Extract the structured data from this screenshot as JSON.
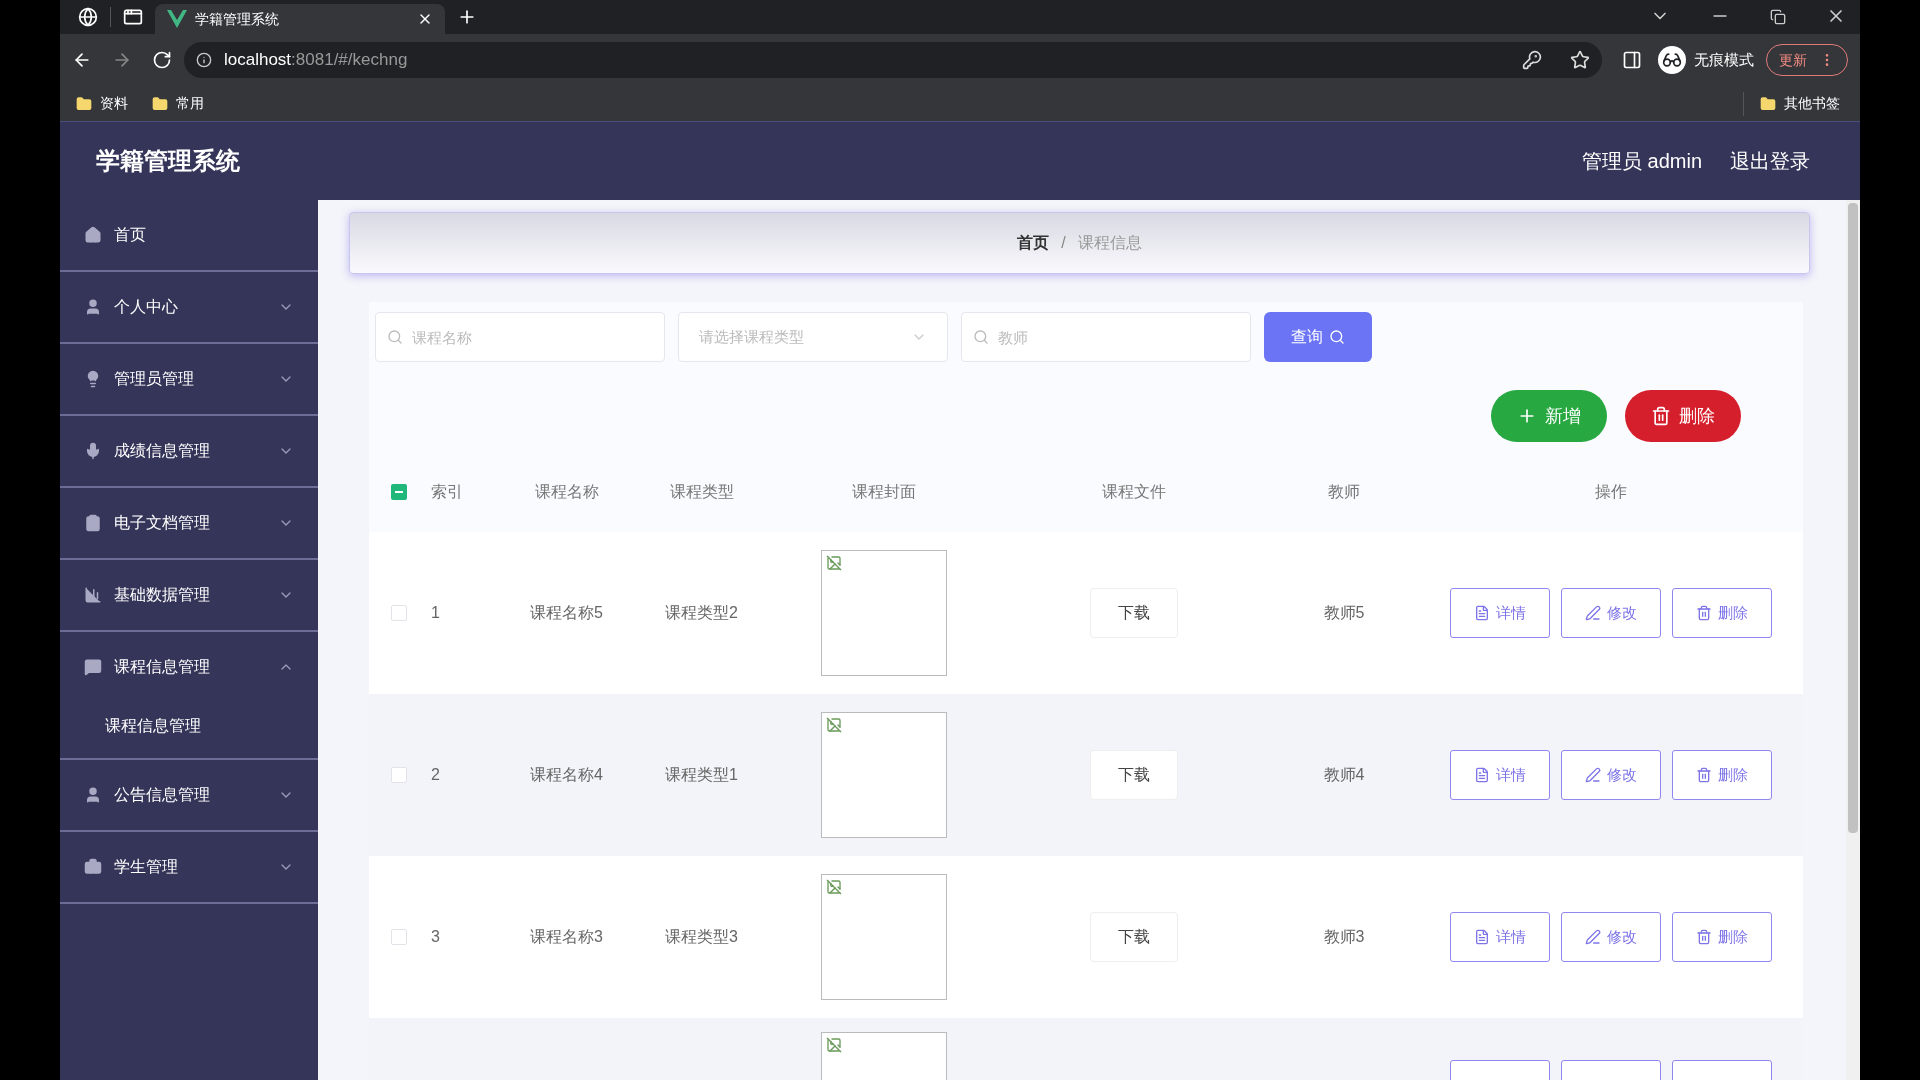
{
  "browser": {
    "tab_title": "学籍管理系统",
    "url_host": "localhost",
    "url_rest": ":8081/#/kechng",
    "incognito_label": "无痕模式",
    "update_label": "更新",
    "bookmarks": [
      {
        "label": "资料"
      },
      {
        "label": "常用"
      }
    ],
    "other_bookmarks": "其他书签"
  },
  "header": {
    "title": "学籍管理系统",
    "user": "管理员 admin",
    "logout": "退出登录"
  },
  "sidebar": {
    "items": [
      {
        "label": "首页"
      },
      {
        "label": "个人中心",
        "expanded": false
      },
      {
        "label": "管理员管理",
        "expanded": false
      },
      {
        "label": "成绩信息管理",
        "expanded": false
      },
      {
        "label": "电子文档管理",
        "expanded": false
      },
      {
        "label": "基础数据管理",
        "expanded": false
      },
      {
        "label": "课程信息管理",
        "expanded": true,
        "children": [
          {
            "label": "课程信息管理"
          }
        ]
      },
      {
        "label": "公告信息管理",
        "expanded": false
      },
      {
        "label": "学生管理",
        "expanded": false
      }
    ]
  },
  "breadcrumb": [
    "首页",
    "课程信息"
  ],
  "breadcrumb_separator": "/",
  "search": {
    "name_placeholder": "课程名称",
    "type_placeholder": "请选择课程类型",
    "teacher_placeholder": "教师",
    "query_button": "查询"
  },
  "actions": {
    "add": "新增",
    "delete": "删除"
  },
  "table": {
    "select_all_indeterminate": true,
    "columns": [
      "索引",
      "课程名称",
      "课程类型",
      "课程封面",
      "课程文件",
      "教师",
      "操作"
    ],
    "rows": [
      {
        "kind": "full",
        "checked": false,
        "index": "1",
        "name": "课程名称5",
        "type": "课程类型2",
        "file": "下载",
        "teacher": "教师5",
        "ops": [
          "详情",
          "修改",
          "删除"
        ]
      },
      {
        "kind": "full",
        "checked": false,
        "index": "2",
        "name": "课程名称4",
        "type": "课程类型1",
        "file": "下载",
        "teacher": "教师4",
        "ops": [
          "详情",
          "修改",
          "删除"
        ]
      },
      {
        "kind": "full",
        "checked": false,
        "index": "3",
        "name": "课程名称3",
        "type": "课程类型3",
        "file": "下载",
        "teacher": "教师3",
        "ops": [
          "详情",
          "修改",
          "删除"
        ]
      },
      {
        "kind": "cut"
      }
    ]
  }
}
